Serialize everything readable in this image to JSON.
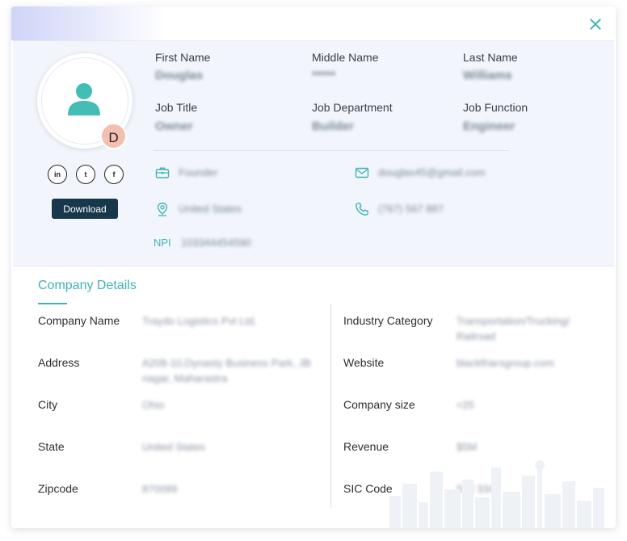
{
  "profile": {
    "avatar_initial": "D",
    "download_label": "Download",
    "social_linkedin": "in",
    "social_twitter": "t",
    "social_facebook": "f",
    "first_name_label": "First Name",
    "first_name": "Douglas",
    "middle_name_label": "Middle Name",
    "middle_name": "*****",
    "last_name_label": "Last Name",
    "last_name": "Williams",
    "job_title_label": "Job Title",
    "job_title": "Owner",
    "job_department_label": "Job Department",
    "job_department": "Builder",
    "job_function_label": "Job Function",
    "job_function": "Engineer",
    "position": "Founder",
    "email": "douglas45@gmail.com",
    "location": "United States",
    "phone": "(767) 567 887",
    "npi_label": "NPI",
    "npi": "103344454590"
  },
  "company": {
    "title": "Company Details",
    "company_name_label": "Company Name",
    "company_name": "Traydo Logistics Pvt Ltd.",
    "address_label": "Address",
    "address": "A208-10,Dynasty Business Park, JB nagar, Maharastra",
    "city_label": "City",
    "city": "Ohio",
    "state_label": "State",
    "state": "United States",
    "zipcode_label": "Zipcode",
    "zipcode": "870099",
    "industry_label": "Industry Category",
    "industry": "Transportation/Trucking/ Railroad",
    "website_label": "Website",
    "website": "blackfriarsgroup.com",
    "size_label": "Company size",
    "size": "<25",
    "revenue_label": "Revenue",
    "revenue": "$5M",
    "sic_label": "SIC Code",
    "sic": "562 334"
  },
  "colors": {
    "accent": "#3fb3b5",
    "button_dark": "#17384a",
    "badge": "#f3bfb0",
    "panel_bg": "#f2f6fc"
  },
  "icons": {
    "close": "close-icon",
    "avatar": "person-icon",
    "briefcase": "briefcase-icon",
    "email": "mail-icon",
    "location": "location-pin-icon",
    "phone": "phone-icon"
  }
}
